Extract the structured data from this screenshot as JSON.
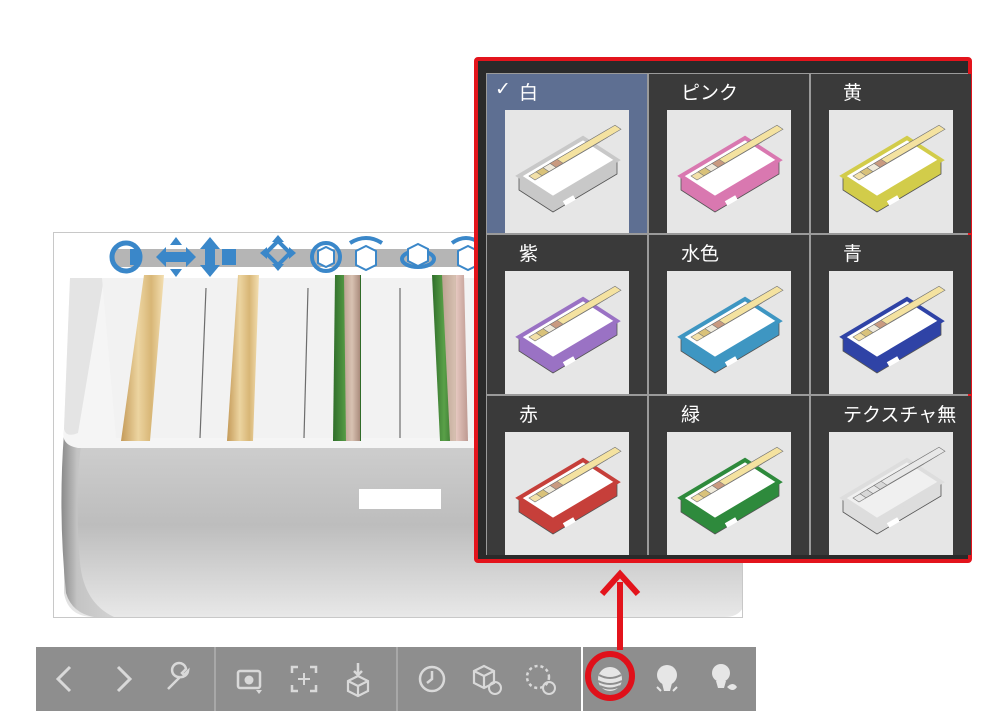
{
  "color_panel": {
    "options": [
      {
        "label": "白",
        "selected": true,
        "color": "#c8c8c8"
      },
      {
        "label": "ピンク",
        "selected": false,
        "color": "#d978b0"
      },
      {
        "label": "黄",
        "selected": false,
        "color": "#d2cc4a"
      },
      {
        "label": "紫",
        "selected": false,
        "color": "#9a72c4"
      },
      {
        "label": "水色",
        "selected": false,
        "color": "#3e96c2"
      },
      {
        "label": "青",
        "selected": false,
        "color": "#2f43a6"
      },
      {
        "label": "赤",
        "selected": false,
        "color": "#c63f3a"
      },
      {
        "label": "緑",
        "selected": false,
        "color": "#2e8a3c"
      },
      {
        "label": "テクスチャ無",
        "selected": false,
        "color": "#dddddd"
      }
    ],
    "check_mark": "✓"
  },
  "accent_colors": {
    "highlight": "#e3141c",
    "selected_cell": "#5e6f92"
  },
  "toolbar": {
    "buttons": [
      "back-icon",
      "forward-icon",
      "wrench-icon",
      "camera-icon",
      "fit-view-icon",
      "place-on-floor-icon",
      "timer-icon",
      "object-rotate-icon",
      "rotate-dotted-icon",
      "color-sphere-icon",
      "light-bulb-icon",
      "light-settings-icon"
    ]
  },
  "manipulators": [
    "rotate-icon",
    "move-horizontal-icon",
    "move-vertical-icon",
    "move-all-icon",
    "rotate-y-icon",
    "rotate-x-icon",
    "rotate-z-icon",
    "rotate-extra-icon"
  ]
}
